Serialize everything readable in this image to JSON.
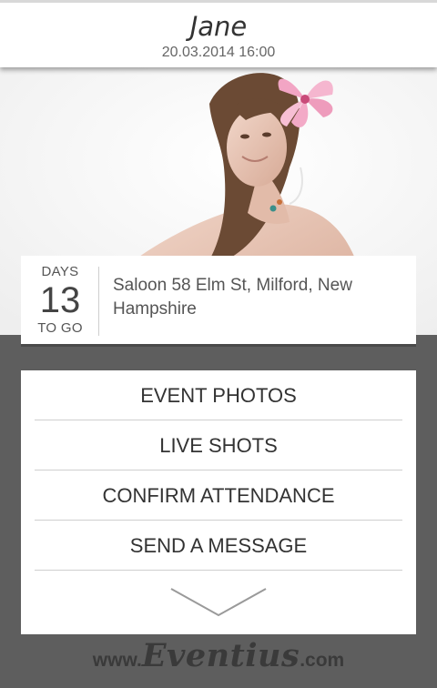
{
  "header": {
    "title": "Jane",
    "datetime": "20.03.2014 16:00"
  },
  "countdown": {
    "top_label": "DAYS",
    "days": "13",
    "bottom_label": "TO GO"
  },
  "event": {
    "address": "Saloon 58 Elm St, Milford, New Hampshire"
  },
  "menu": {
    "items": [
      {
        "label": "EVENT PHOTOS"
      },
      {
        "label": "LIVE SHOTS"
      },
      {
        "label": "CONFIRM ATTENDANCE"
      },
      {
        "label": "SEND A MESSAGE"
      }
    ],
    "more_icon": "chevron-down-icon"
  },
  "footer": {
    "prefix": "www.",
    "brand": "Eventius",
    "suffix": ".com"
  },
  "colors": {
    "background": "#5e5e5e",
    "card": "#ffffff",
    "text": "#333333"
  }
}
